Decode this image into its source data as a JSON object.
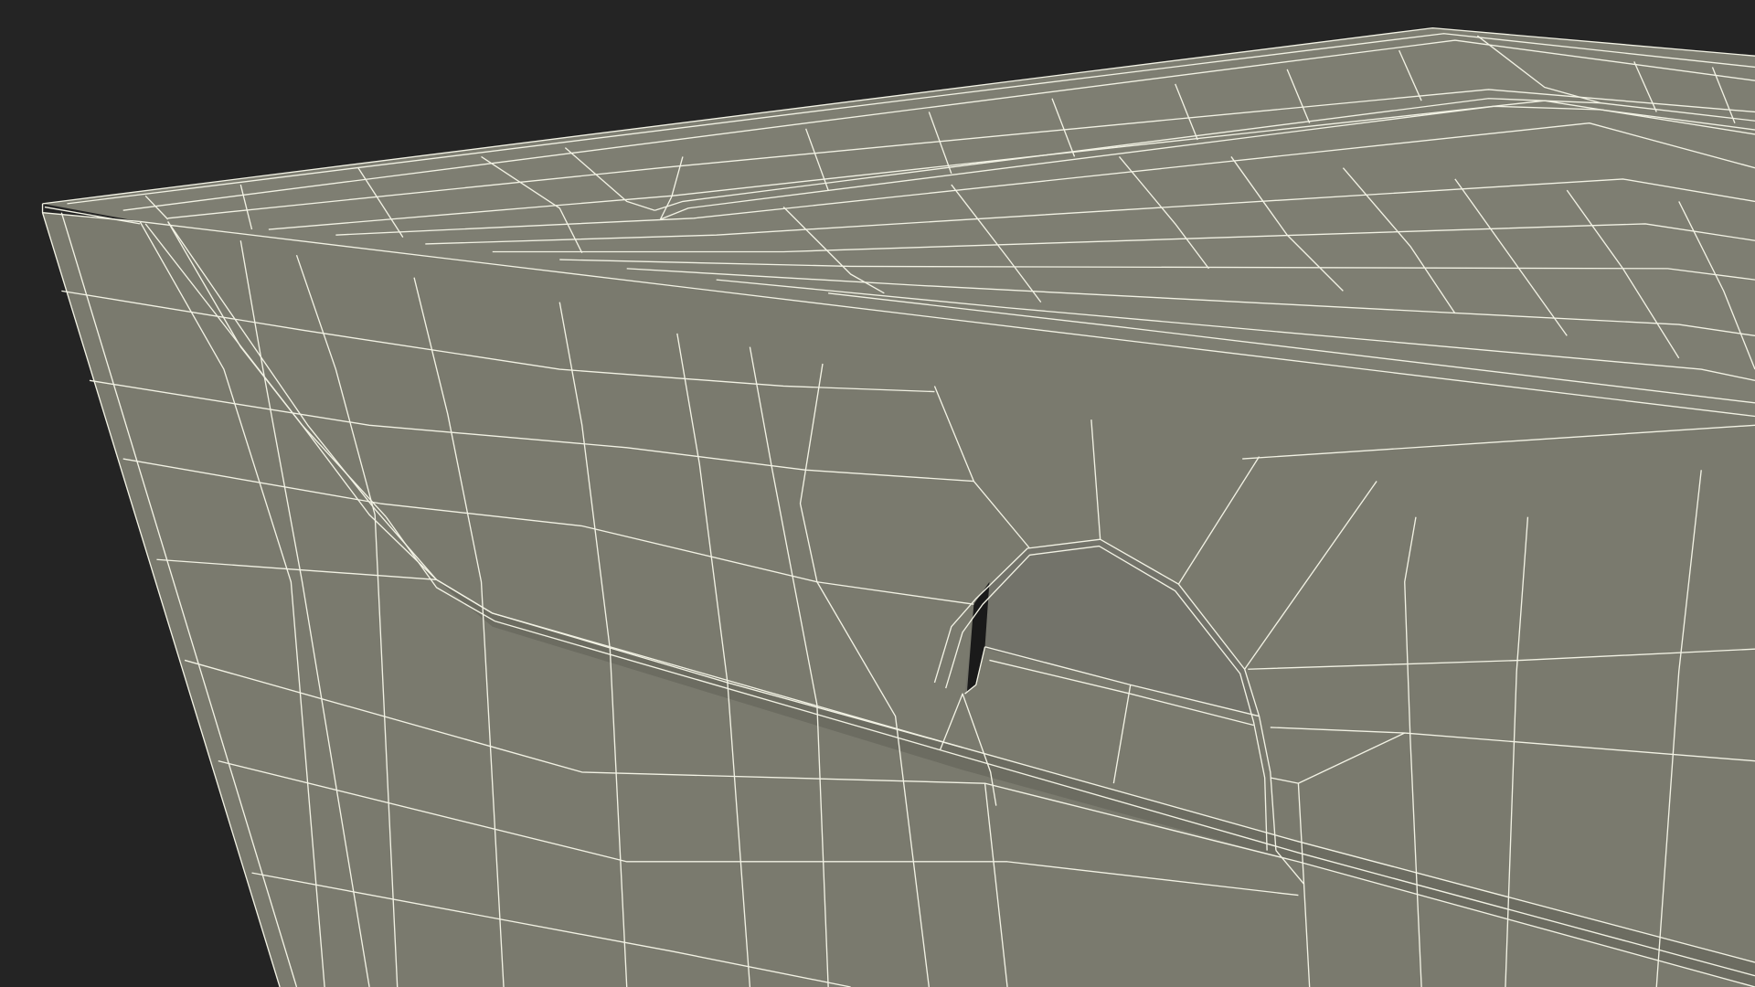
{
  "scene": {
    "subject": "wireframe-3d-box-corner",
    "colors": {
      "background": "#242424",
      "surface": "#7a7a6e",
      "surface_top": "#7e7e72",
      "surface_shadow": "#6e6e63",
      "wire": "#f2f2e4",
      "hole": "#1a1a1a"
    }
  }
}
